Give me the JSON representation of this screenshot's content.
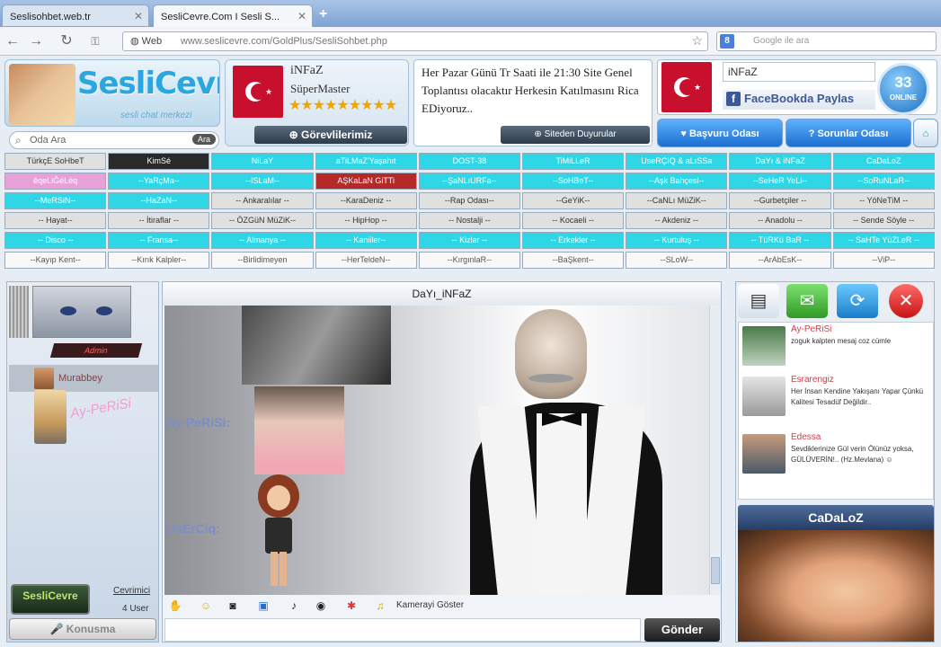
{
  "browser": {
    "tabs": [
      {
        "label": "Seslisohbet.web.tr",
        "active": false
      },
      {
        "label": "SesliCevre.Com I Sesli S...",
        "active": true
      }
    ],
    "new_tab": "+",
    "chip": "Web",
    "url": "www.seslicevre.com/GoldPlus/SesliSohbet.php",
    "search_placeholder": "Google ile ara",
    "google_letter": "8"
  },
  "header": {
    "logo_text": "SesliCevre",
    "logo_tagline": "sesli chat merkezi",
    "room_search_label": "Oda Ara",
    "room_search_btn": "Ara",
    "user_name": "iNFaZ",
    "user_role": "SüperMaster",
    "user_stars": "★★★★★★★★★",
    "duties_btn": "Görevlilerimiz",
    "announcement": "Her Pazar Günü Tr Saati ile 21:30 Site Genel Toplantısı olacaktır Herkesin Katılmasını Rica EDiyoruz..",
    "announcements_btn": "Siteden Duyurular",
    "right_user": "iNFaZ",
    "facebook_share": "FaceBookda Paylas",
    "online_count": "33",
    "online_label": "ONLINE",
    "btn_bos": "Başvuru Odası",
    "btn_sorunlar": "Sorunlar Odası"
  },
  "rooms": [
    [
      "TürkçE SoHbeT",
      "KimSé",
      "NiLaY",
      "aTiLMaZ'Yaşahıt",
      "DOST-38",
      "TiMiLLeR",
      "UseRÇIQ & aLıSSa",
      "DaYı & iNFaZ",
      "CaDaLoZ"
    ],
    [
      "êqeLiĞéLéq",
      "--YaRçMa--",
      "--ISLaM--",
      "AŞKaLaN GiTTi",
      "--ŞaNLıURFa--",
      "--SoHBeT--",
      "--Aşk Bahçesi--",
      "--SeHeR YeLi--",
      "--SoRuNLaR--"
    ],
    [
      "--MeRSiN--",
      "--HaZaN--",
      "-- Ankaralılar --",
      "--KaraDeniz --",
      "--Rap Odası--",
      "--GeYiK--",
      "--CaNLı MüZiK--",
      "--Gurbetçiler --",
      "-- YöNeTiM --"
    ],
    [
      "-- Hayat--",
      "-- İtiraflar --",
      "-- ÖZGüN MüZiK--",
      "-- HipHop --",
      "-- Nostalji --",
      "-- Kocaeli --",
      "-- Akdeniz --",
      "-- Anadolu --",
      "-- Sende Söyle --"
    ],
    [
      "-- Disco --",
      "-- Fransa--",
      "-- Almanya --",
      "-- Kaniiler--",
      "-- Kizlar --",
      "-- Erkekler --",
      "-- Kurtuluş --",
      "-- TüRKü BaR --",
      "-- SaHTe YüZLeR --"
    ],
    [
      "--Kayıp Kent--",
      "--Kırık Kalpler--",
      "--Birlidimeyen",
      "--HerTeldeN--",
      "--KırgınlaR--",
      "--BaŞkent--",
      "--SLoW--",
      "--ArAbEsK--",
      "--ViP--"
    ]
  ],
  "room_colors": [
    [
      "grey",
      "dark",
      "cyan",
      "cyan",
      "cyan",
      "cyan",
      "cyan",
      "cyan",
      "cyan"
    ],
    [
      "pink",
      "cyan",
      "cyan",
      "red",
      "cyan",
      "cyan",
      "cyan",
      "cyan",
      "cyan"
    ],
    [
      "cyan",
      "cyan",
      "grey",
      "grey",
      "grey",
      "grey",
      "grey",
      "grey",
      "grey"
    ],
    [
      "grey",
      "grey",
      "grey",
      "grey",
      "grey",
      "grey",
      "grey",
      "grey",
      "grey"
    ],
    [
      "cyan",
      "cyan",
      "cyan",
      "cyan",
      "cyan",
      "cyan",
      "cyan",
      "cyan",
      "cyan"
    ],
    [
      "white",
      "white",
      "white",
      "white",
      "white",
      "white",
      "white",
      "white",
      "white"
    ]
  ],
  "userlist": {
    "banner": "Admin",
    "users": [
      {
        "name": "Murabbey"
      },
      {
        "name": "Ay-PeRiSi"
      }
    ],
    "badge": "SesliCevre",
    "online_link": "Cevrimici",
    "user_count": "4 User",
    "talk_btn": "Konusma"
  },
  "chat": {
    "title": "DaYı_iNFaZ",
    "label_ay": "Ay-PeRiSi:",
    "label_us": "UsErCiq:",
    "camera": "Kamerayi Göster",
    "send": "Gönder"
  },
  "feed": [
    {
      "name": "Ay-PeRiSi",
      "text": "zoguk kalpten mesaj coz cümle"
    },
    {
      "name": "Esrarengiz",
      "text": "Her İnsan Kendine Yakışanı Yapar Çünkü Kalitesi Tesadüf Değildir.."
    },
    {
      "name": "Edessa",
      "text": "Sevdiklerinize Gül verin Ölünüz yoksa, GÜLÜVERİN!.. (Hz.Mevlana) ☺"
    }
  ],
  "promo_name": "CaDaLoZ"
}
